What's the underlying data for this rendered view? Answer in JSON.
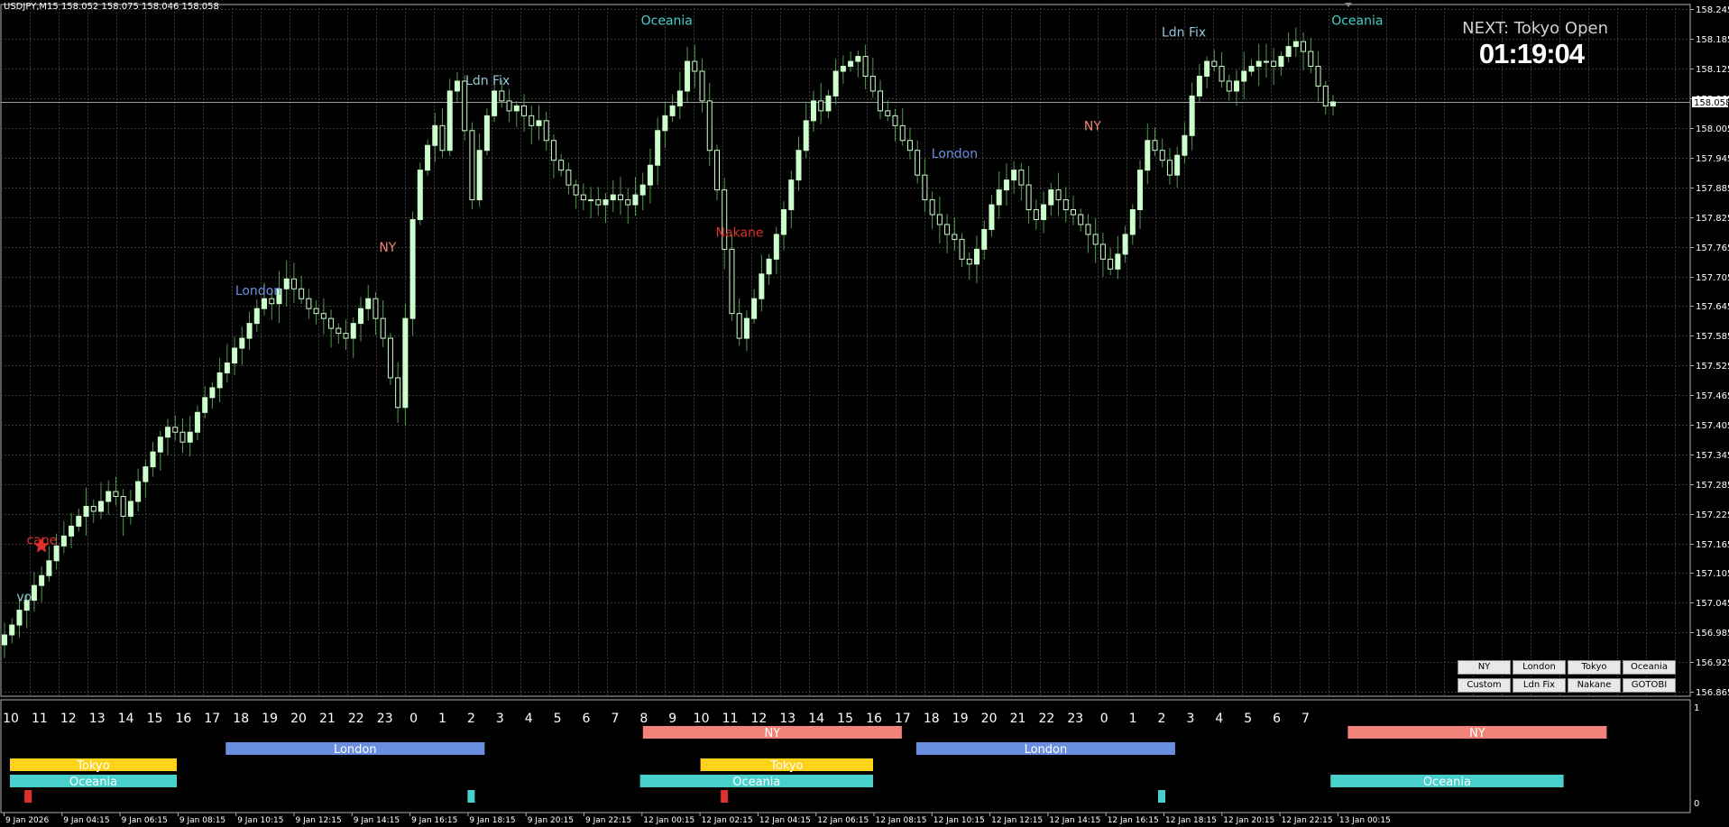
{
  "chart_title": "USDJPY,M15  158.052 158.075 158.046 158.058",
  "next_label": "NEXT: Tokyo Open",
  "countdown": "01:19:04",
  "current_price": "158.058",
  "colors": {
    "background": "#000000",
    "grid": "#3c3c3c",
    "bull_body": "#ccffcc",
    "wick": "#4e9a4e",
    "ny": "#f08278",
    "london": "#6a8fe0",
    "tokyo": "#ffd21a",
    "oceania": "#48d1cc",
    "ldn_fix": "#90c8d8",
    "nakane": "#e03030"
  },
  "buttons": [
    "NY",
    "London",
    "Tokyo",
    "Oceania",
    "Custom",
    "Ldn Fix",
    "Nakane",
    "GOTOBI"
  ],
  "hours": [
    "10",
    "11",
    "12",
    "13",
    "14",
    "15",
    "16",
    "17",
    "18",
    "19",
    "20",
    "21",
    "22",
    "23",
    "0",
    "1",
    "2",
    "3",
    "4",
    "5",
    "6",
    "7",
    "8",
    "9",
    "10",
    "11",
    "12",
    "13",
    "14",
    "15",
    "16",
    "17",
    "18",
    "19",
    "20",
    "21",
    "22",
    "23",
    "0",
    "1",
    "2",
    "3",
    "4",
    "5",
    "6",
    "7"
  ],
  "time_labels": [
    "9 Jan 2026",
    "9 Jan 04:15",
    "9 Jan 06:15",
    "9 Jan 08:15",
    "9 Jan 10:15",
    "9 Jan 12:15",
    "9 Jan 14:15",
    "9 Jan 16:15",
    "9 Jan 18:15",
    "9 Jan 20:15",
    "9 Jan 22:15",
    "12 Jan 00:15",
    "12 Jan 02:15",
    "12 Jan 04:15",
    "12 Jan 06:15",
    "12 Jan 08:15",
    "12 Jan 10:15",
    "12 Jan 12:15",
    "12 Jan 14:15",
    "12 Jan 16:15",
    "12 Jan 18:15",
    "12 Jan 20:15",
    "12 Jan 22:15",
    "13 Jan 00:15"
  ],
  "indicator_scale": [
    "1",
    "0"
  ],
  "session_bars": [
    {
      "label": "NY",
      "row": 0,
      "start": 22,
      "end": 31,
      "color": "ny"
    },
    {
      "label": "NY",
      "row": 0,
      "start": 46.5,
      "end": 55.5,
      "color": "ny"
    },
    {
      "label": "London",
      "row": 1,
      "start": 7.5,
      "end": 16.5,
      "color": "london"
    },
    {
      "label": "London",
      "row": 1,
      "start": 31.5,
      "end": 40.5,
      "color": "london"
    },
    {
      "label": "Tokyo",
      "row": 2,
      "start": 0,
      "end": 5.8,
      "color": "tokyo"
    },
    {
      "label": "Tokyo",
      "row": 2,
      "start": 24,
      "end": 30,
      "color": "tokyo"
    },
    {
      "label": "Oceania",
      "row": 3,
      "start": 0,
      "end": 5.8,
      "color": "oceania"
    },
    {
      "label": "Oceania",
      "row": 3,
      "start": 21.9,
      "end": 30,
      "color": "oceania"
    },
    {
      "label": "Oceania",
      "row": 3,
      "start": 45.9,
      "end": 54,
      "color": "oceania"
    }
  ],
  "markers": [
    {
      "pos": 0.6,
      "color": "nakane"
    },
    {
      "pos": 16,
      "color": "oceania"
    },
    {
      "pos": 24.8,
      "color": "nakane"
    },
    {
      "pos": 40,
      "color": "oceania"
    }
  ],
  "chart_labels": [
    {
      "text": "Oceania",
      "pos": 21.9,
      "price": 158.214,
      "color": "oceania"
    },
    {
      "text": "Ldn Fix",
      "pos": 15.8,
      "price": 158.093,
      "color": "ldn_fix"
    },
    {
      "text": "London",
      "pos": 7.8,
      "price": 157.668,
      "color": "london"
    },
    {
      "text": "NY",
      "pos": 12.8,
      "price": 157.755,
      "color": "ny"
    },
    {
      "text": "Nakane",
      "pos": 24.5,
      "price": 157.785,
      "color": "nakane"
    },
    {
      "text": "Oceania",
      "pos": 45.9,
      "price": 158.214,
      "color": "oceania"
    },
    {
      "text": "Ldn Fix",
      "pos": 40,
      "price": 158.19,
      "color": "ldn_fix"
    },
    {
      "text": "London",
      "pos": 32,
      "price": 157.945,
      "color": "london"
    },
    {
      "text": "NY",
      "pos": 37.3,
      "price": 158.001,
      "color": "ny"
    },
    {
      "text": "cane",
      "pos": 0.55,
      "price": 157.163,
      "color": "nakane"
    },
    {
      "text": "vo",
      "pos": 0.2,
      "price": 157.048,
      "color": "ldn_fix"
    }
  ],
  "chart_data": {
    "type": "candlestick",
    "symbol": "USDJPY",
    "timeframe": "M15",
    "ohlc": {
      "open": 158.052,
      "high": 158.075,
      "low": 158.046,
      "close": 158.058
    },
    "y_ticks": [
      158.245,
      158.185,
      158.125,
      158.065,
      158.005,
      157.945,
      157.885,
      157.825,
      157.765,
      157.705,
      157.645,
      157.585,
      157.525,
      157.465,
      157.405,
      157.345,
      157.285,
      157.225,
      157.165,
      157.105,
      157.045,
      156.985,
      156.925,
      156.865
    ],
    "ylim": [
      156.856,
      158.255
    ],
    "grid": true,
    "closes": [
      156.98,
      157.0,
      157.03,
      157.05,
      157.08,
      157.1,
      157.13,
      157.16,
      157.18,
      157.2,
      157.22,
      157.24,
      157.23,
      157.25,
      157.27,
      157.26,
      157.22,
      157.25,
      157.29,
      157.32,
      157.35,
      157.38,
      157.4,
      157.39,
      157.37,
      157.39,
      157.43,
      157.46,
      157.48,
      157.51,
      157.53,
      157.56,
      157.58,
      157.61,
      157.64,
      157.66,
      157.65,
      157.68,
      157.7,
      157.68,
      157.66,
      157.64,
      157.63,
      157.62,
      157.6,
      157.59,
      157.58,
      157.61,
      157.64,
      157.66,
      157.62,
      157.58,
      157.5,
      157.44,
      157.62,
      157.82,
      157.92,
      157.97,
      158.01,
      157.96,
      158.08,
      158.1,
      158.0,
      157.86,
      157.96,
      158.03,
      158.08,
      158.06,
      158.04,
      158.05,
      158.03,
      158.01,
      158.02,
      157.98,
      157.94,
      157.92,
      157.89,
      157.87,
      157.86,
      157.86,
      157.85,
      157.86,
      157.87,
      157.86,
      157.85,
      157.87,
      157.89,
      157.93,
      158.0,
      158.03,
      158.05,
      158.08,
      158.14,
      158.12,
      158.06,
      157.96,
      157.88,
      157.76,
      157.63,
      157.58,
      157.62,
      157.66,
      157.71,
      157.74,
      157.79,
      157.84,
      157.9,
      157.96,
      158.02,
      158.06,
      158.04,
      158.07,
      158.12,
      158.13,
      158.14,
      158.15,
      158.11,
      158.08,
      158.04,
      158.03,
      158.01,
      157.98,
      157.96,
      157.91,
      157.86,
      157.83,
      157.81,
      157.79,
      157.78,
      157.74,
      157.73,
      157.76,
      157.8,
      157.85,
      157.88,
      157.9,
      157.92,
      157.89,
      157.84,
      157.82,
      157.85,
      157.88,
      157.86,
      157.84,
      157.83,
      157.81,
      157.79,
      157.77,
      157.74,
      157.72,
      157.75,
      157.79,
      157.84,
      157.92,
      157.98,
      157.96,
      157.94,
      157.91,
      157.95,
      157.99,
      158.07,
      158.11,
      158.14,
      158.13,
      158.1,
      158.08,
      158.1,
      158.12,
      158.13,
      158.14,
      158.14,
      158.13,
      158.15,
      158.17,
      158.18,
      158.16,
      158.13,
      158.09,
      158.05,
      158.058
    ]
  }
}
